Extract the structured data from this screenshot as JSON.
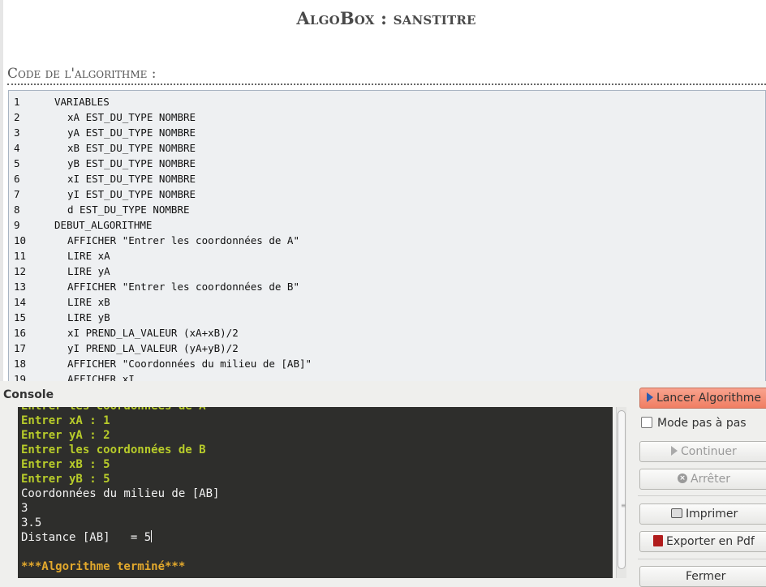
{
  "window": {
    "title": "AlgoBox : sanstitre"
  },
  "code_section": {
    "heading": "Code de l'algorithme :",
    "lines": [
      {
        "n": "1",
        "text": "VARIABLES",
        "indent": 0
      },
      {
        "n": "2",
        "text": "xA EST_DU_TYPE NOMBRE",
        "indent": 1
      },
      {
        "n": "3",
        "text": "yA EST_DU_TYPE NOMBRE",
        "indent": 1
      },
      {
        "n": "4",
        "text": "xB EST_DU_TYPE NOMBRE",
        "indent": 1
      },
      {
        "n": "5",
        "text": "yB EST_DU_TYPE NOMBRE",
        "indent": 1
      },
      {
        "n": "6",
        "text": "xI EST_DU_TYPE NOMBRE",
        "indent": 1
      },
      {
        "n": "7",
        "text": "yI EST_DU_TYPE NOMBRE",
        "indent": 1
      },
      {
        "n": "8",
        "text": "d EST_DU_TYPE NOMBRE",
        "indent": 1
      },
      {
        "n": "9",
        "text": "DEBUT_ALGORITHME",
        "indent": 0
      },
      {
        "n": "10",
        "text": "AFFICHER \"Entrer les coordonnées de A\"",
        "indent": 1
      },
      {
        "n": "11",
        "text": "LIRE xA",
        "indent": 1
      },
      {
        "n": "12",
        "text": "LIRE yA",
        "indent": 1
      },
      {
        "n": "13",
        "text": "AFFICHER \"Entrer les coordonnées de B\"",
        "indent": 1
      },
      {
        "n": "14",
        "text": "LIRE xB",
        "indent": 1
      },
      {
        "n": "15",
        "text": "LIRE yB",
        "indent": 1
      },
      {
        "n": "16",
        "text": "xI PREND_LA_VALEUR (xA+xB)/2",
        "indent": 1
      },
      {
        "n": "17",
        "text": "yI PREND_LA_VALEUR (yA+yB)/2",
        "indent": 1
      },
      {
        "n": "18",
        "text": "AFFICHER \"Coordonnées du milieu de [AB]\"",
        "indent": 1
      },
      {
        "n": "19",
        "text": "AFFICHER xI",
        "indent": 1
      }
    ]
  },
  "console": {
    "label": "Console",
    "lines": [
      {
        "text": "Entrer les coordonnées de A",
        "style": "green"
      },
      {
        "text": "Entrer xA : 1",
        "style": "green"
      },
      {
        "text": "Entrer yA : 2",
        "style": "green"
      },
      {
        "text": "Entrer les coordonnées de B",
        "style": "green"
      },
      {
        "text": "Entrer xB : 5",
        "style": "green"
      },
      {
        "text": "Entrer yB : 5",
        "style": "green"
      },
      {
        "text": "Coordonnées du milieu de [AB]",
        "style": "white"
      },
      {
        "text": "3",
        "style": "white"
      },
      {
        "text": "3.5",
        "style": "white"
      },
      {
        "text": "Distance [AB]   = 5",
        "style": "white",
        "caret": true
      },
      {
        "text": "",
        "style": "white"
      },
      {
        "text": "***Algorithme terminé***",
        "style": "orange"
      }
    ]
  },
  "controls": {
    "run_label": "Lancer Algorithme",
    "step_label": "Mode pas à pas",
    "step_checked": false,
    "continue_label": "Continuer",
    "stop_label": "Arrêter",
    "print_label": "Imprimer",
    "pdf_label": "Exporter en Pdf",
    "close_label": "Fermer"
  },
  "colors": {
    "run_button": "#f07e63",
    "console_bg": "#2e2e2c",
    "console_input": "#b8cc2a",
    "console_end": "#e3a92c"
  }
}
